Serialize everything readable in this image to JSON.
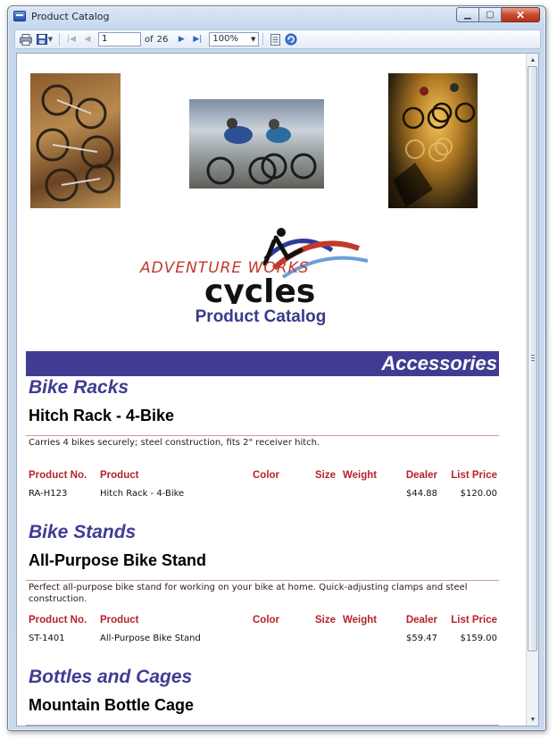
{
  "window": {
    "title": "Product Catalog"
  },
  "toolbar": {
    "page_current": "1",
    "page_of": "of",
    "page_total": "26",
    "zoom": "100%"
  },
  "report": {
    "brand_line1": "ADVENTURE WORKS",
    "brand_line2": "cycles",
    "catalog_title": "Product Catalog",
    "category": "Accessories",
    "columns": {
      "product_no": "Product No.",
      "product": "Product",
      "color": "Color",
      "size": "Size",
      "weight": "Weight",
      "dealer": "Dealer",
      "list_price": "List Price"
    },
    "groups": [
      {
        "subcategory": "Bike Racks",
        "product_name": "Hitch Rack - 4-Bike",
        "description": "Carries 4 bikes securely; steel construction, fits 2\" receiver hitch.",
        "row": {
          "product_no": "RA-H123",
          "product": "Hitch Rack - 4-Bike",
          "color": "",
          "size": "",
          "weight": "",
          "dealer": "$44.88",
          "list_price": "$120.00"
        }
      },
      {
        "subcategory": "Bike Stands",
        "product_name": "All-Purpose Bike Stand",
        "description": "Perfect all-purpose bike stand for working on your bike at home. Quick-adjusting clamps and steel construction.",
        "row": {
          "product_no": "ST-1401",
          "product": "All-Purpose Bike Stand",
          "color": "",
          "size": "",
          "weight": "",
          "dealer": "$59.47",
          "list_price": "$159.00"
        }
      },
      {
        "subcategory": "Bottles and Cages",
        "product_name": "Mountain Bottle Cage"
      }
    ]
  },
  "colors": {
    "header_bar": "#403c93",
    "column_header": "#b5232a",
    "brand_red": "#c0392b"
  }
}
